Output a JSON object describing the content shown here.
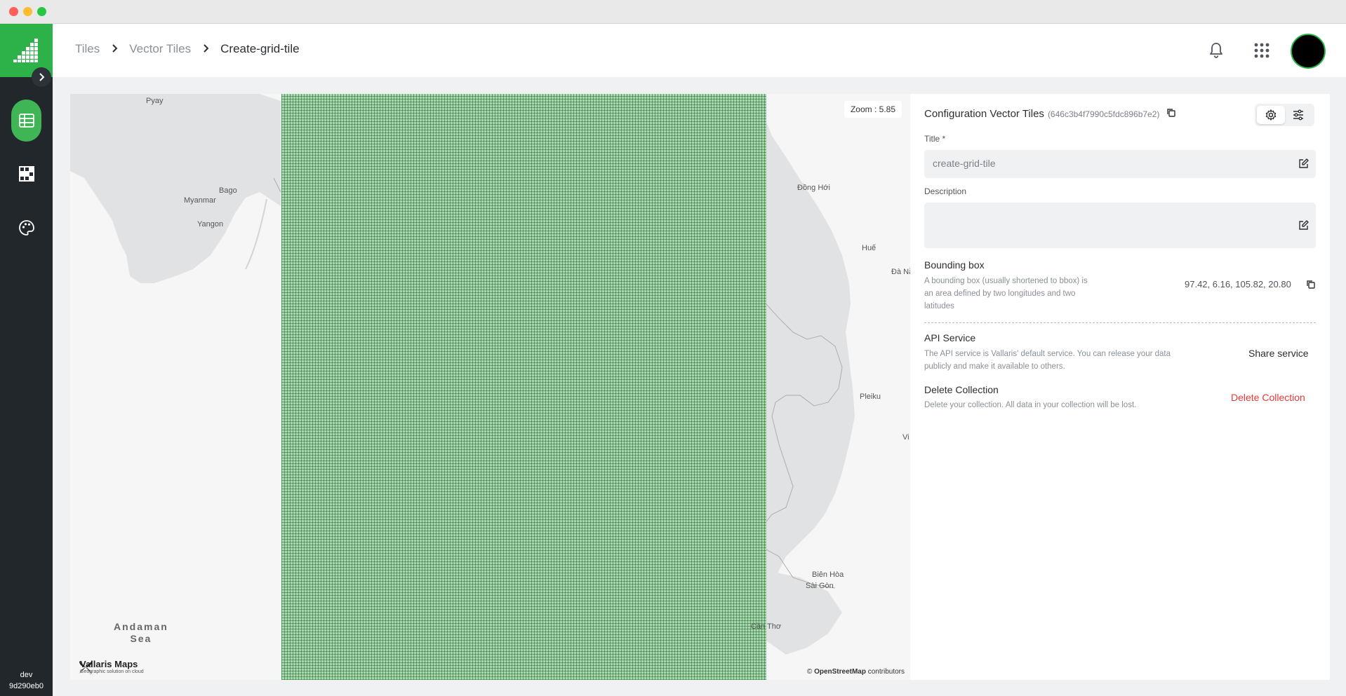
{
  "sidebar": {
    "logo_icon": "vallaris-bars-logo",
    "items": [
      {
        "name": "data",
        "icon": "table-icon",
        "active": true
      },
      {
        "name": "tiles",
        "icon": "tiles-icon",
        "active": false
      },
      {
        "name": "styles",
        "icon": "palette-icon",
        "active": false
      }
    ],
    "footer_env": "dev",
    "footer_build": "9d290eb0"
  },
  "header": {
    "breadcrumb": [
      "Tiles",
      "Vector Tiles",
      "Create-grid-tile"
    ]
  },
  "map": {
    "zoom_text": "Zoom : 5.85",
    "labels": {
      "pyay": "Pyay",
      "bago": "Bago",
      "myanmar": "Myanmar",
      "yangon": "Yangon",
      "dong_hoi": "Đồng Hới",
      "hue": "Huế",
      "da_nang": "Đà Nẵ",
      "pleiku": "Pleiku",
      "vi": "Vi",
      "bien_hoa": "Biên Hòa",
      "sai_gon": "Sài Gòn",
      "can_tho": "Cần Thơ",
      "sea_line1": "Andaman",
      "sea_line2": "Sea"
    },
    "brand_name": "Vallaris Maps",
    "brand_tagline": "Geographic solution on cloud",
    "attribution_prefix": "©",
    "attribution_link": "OpenStreetMap",
    "attribution_suffix": "contributors",
    "overlay_color": "#4caf50"
  },
  "panel": {
    "title": "Configuration Vector Tiles",
    "collection_id": "(646c3b4f7990c5fdc896b7e2)",
    "title_label": "Title *",
    "title_value": "create-grid-tile",
    "description_label": "Description",
    "description_value": "",
    "bbox_title": "Bounding box",
    "bbox_desc": "A bounding box (usually shortened to bbox) is an area defined by two longitudes and two latitudes",
    "bbox_value": "97.42, 6.16, 105.82, 20.80",
    "api_title": "API Service",
    "api_desc": "The API service is Vallaris' default service. You can release your data publicly and make it available to others.",
    "share_label": "Share service",
    "delete_title": "Delete Collection",
    "delete_desc": "Delete your collection. All data in your collection will be lost.",
    "delete_label": "Delete Collection"
  },
  "colors": {
    "brand_green": "#2db24a",
    "sidebar_bg": "#22272b",
    "danger": "#e53935"
  }
}
